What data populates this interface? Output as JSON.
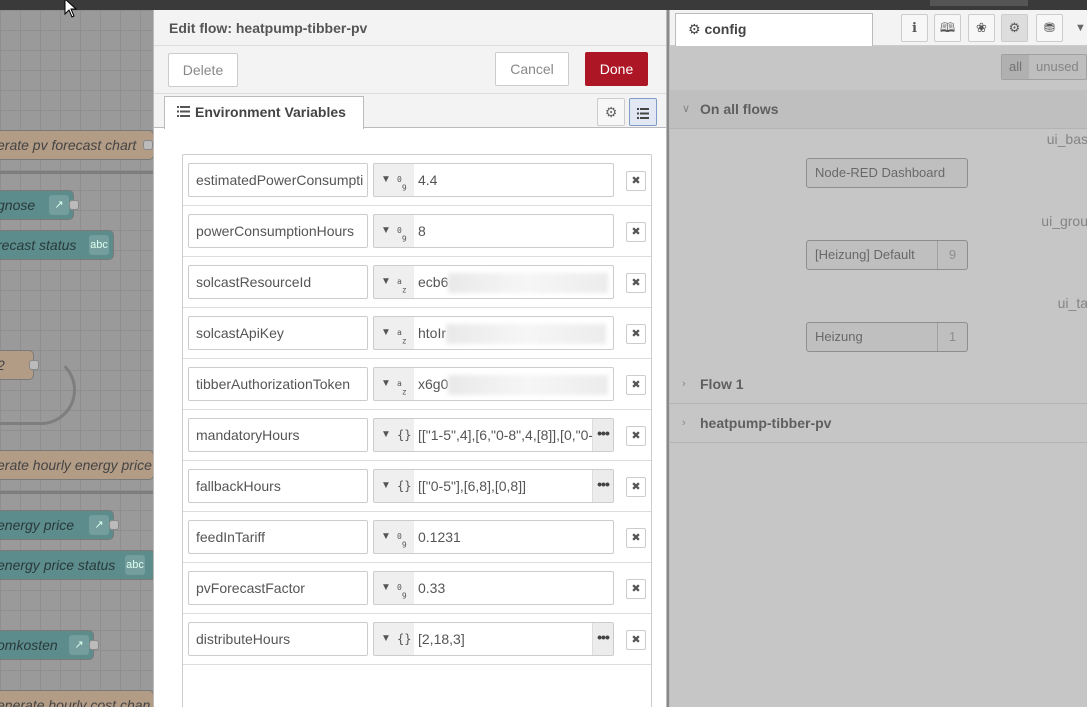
{
  "tray": {
    "title": "Edit flow: heatpump-tibber-pv",
    "delete_label": "Delete",
    "cancel_label": "Cancel",
    "done_label": "Done",
    "tab_label": "Environment Variables",
    "env": [
      {
        "name": "estimatedPowerConsumpti",
        "type": "num",
        "type_icon": "09",
        "value": "4.4",
        "blurred": false,
        "expand": false
      },
      {
        "name": "powerConsumptionHours",
        "type": "num",
        "type_icon": "09",
        "value": "8",
        "blurred": false,
        "expand": false
      },
      {
        "name": "solcastResourceId",
        "type": "str",
        "type_icon": "az",
        "value": "ecb6",
        "blurred": true,
        "expand": false
      },
      {
        "name": "solcastApiKey",
        "type": "str",
        "type_icon": "az",
        "value": "htoIr",
        "blurred": true,
        "expand": false
      },
      {
        "name": "tibberAuthorizationToken",
        "type": "str",
        "type_icon": "az",
        "value": "x6g0",
        "blurred": true,
        "expand": false
      },
      {
        "name": "mandatoryHours",
        "type": "json",
        "type_icon": "{}",
        "value": "[[\"1-5\",4],[6,\"0-8\",4,[8]],[0,\"0-",
        "blurred": false,
        "expand": true
      },
      {
        "name": "fallbackHours",
        "type": "json",
        "type_icon": "{}",
        "value": "[[\"0-5\"],[6,8],[0,8]]",
        "blurred": false,
        "expand": true
      },
      {
        "name": "feedInTariff",
        "type": "num",
        "type_icon": "09",
        "value": "0.1231",
        "blurred": false,
        "expand": false
      },
      {
        "name": "pvForecastFactor",
        "type": "num",
        "type_icon": "09",
        "value": "0.33",
        "blurred": false,
        "expand": false
      },
      {
        "name": "distributeHours",
        "type": "json",
        "type_icon": "{}",
        "value": "[2,18,3]",
        "blurred": false,
        "expand": true
      }
    ]
  },
  "canvas": {
    "nodes": [
      {
        "label": "erate pv forecast chart",
        "style": "tan"
      },
      {
        "label": "gnose",
        "style": "teal",
        "icon": "chart-icon"
      },
      {
        "label": "recast status",
        "style": "teal",
        "icon": "text-icon",
        "chip_text": "abc"
      },
      {
        "label": "2",
        "style": "tan"
      },
      {
        "label": "erate hourly energy price",
        "style": "tan"
      },
      {
        "label": "energy price",
        "style": "teal",
        "icon": "chart-icon"
      },
      {
        "label": "energy price status",
        "style": "teal",
        "icon": "text-icon",
        "chip_text": "abc"
      },
      {
        "label": "omkosten",
        "style": "teal",
        "icon": "chart-icon"
      },
      {
        "label": "enerate hourly cost chan",
        "style": "tan"
      }
    ]
  },
  "sidebar": {
    "tab_label": "config",
    "filter_all": "all",
    "filter_unused": "unused",
    "sections": {
      "all_flows": "On all flows",
      "flow1": "Flow 1",
      "heatpump": "heatpump-tibber-pv"
    },
    "categories": [
      {
        "label": "ui_bas",
        "node": "Node-RED Dashboard",
        "count": ""
      },
      {
        "label": "ui_grou",
        "node": "[Heizung] Default",
        "count": "9"
      },
      {
        "label": "ui_ta",
        "node": "Heizung",
        "count": "1"
      }
    ]
  },
  "colors": {
    "done": "#ad1625",
    "node_tan": "#b39c86",
    "node_teal": "#5c8c8c"
  }
}
